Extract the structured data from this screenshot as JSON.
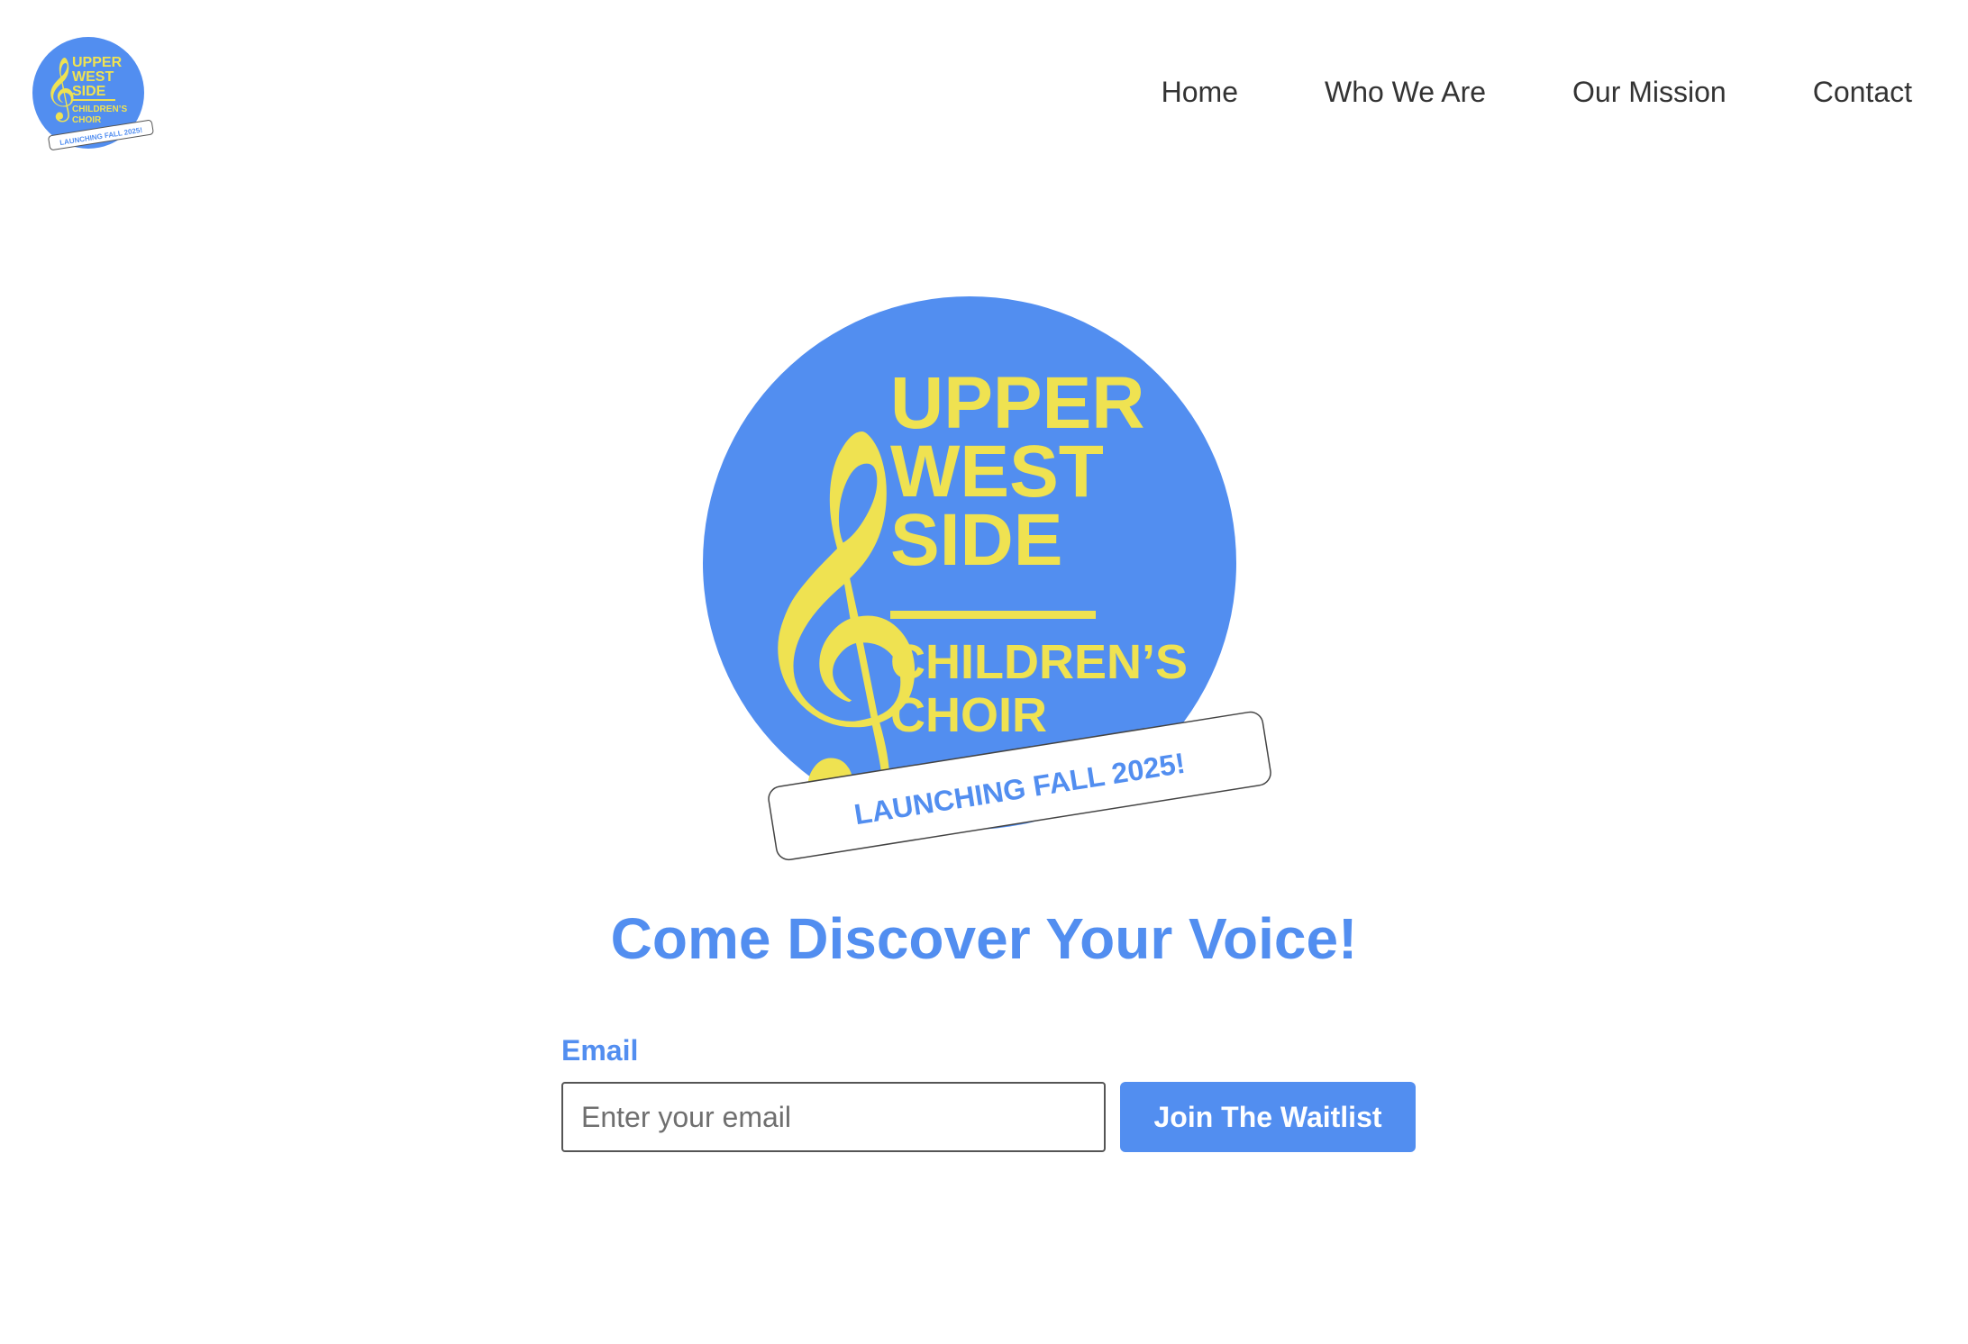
{
  "nav": {
    "items": [
      {
        "label": "Home"
      },
      {
        "label": "Who We Are"
      },
      {
        "label": "Our Mission"
      },
      {
        "label": "Contact"
      }
    ]
  },
  "logo": {
    "line1": "UPPER",
    "line2": "WEST",
    "line3": "SIDE",
    "line4": "CHILDREN’S",
    "line5": "CHOIR",
    "banner": "LAUNCHING FALL 2025!",
    "icon": "treble-clef-icon"
  },
  "hero": {
    "headline": "Come Discover Your Voice!"
  },
  "form": {
    "email_label": "Email",
    "email_placeholder": "Enter your email",
    "submit_label": "Join The Waitlist"
  },
  "colors": {
    "brand_blue": "#528ef0",
    "brand_yellow": "#efe251",
    "nav_text": "#333333"
  }
}
